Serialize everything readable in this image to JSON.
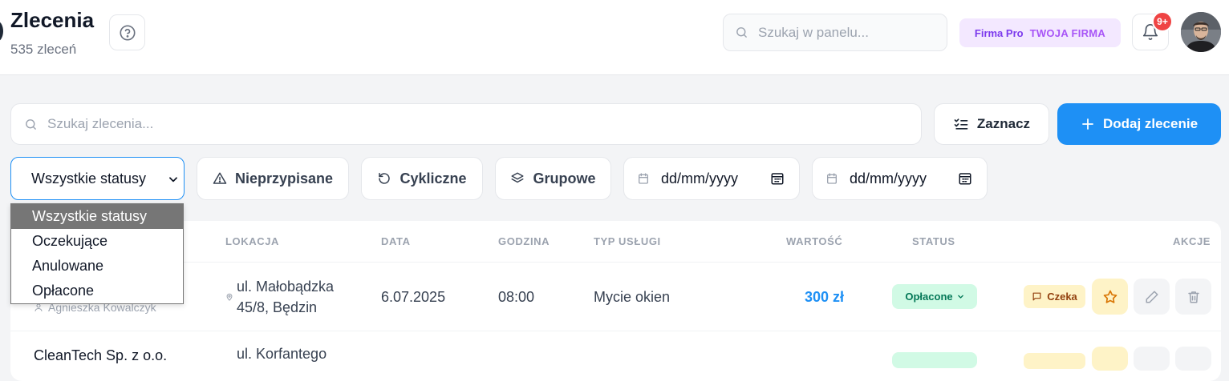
{
  "header": {
    "title": "Zlecenia",
    "subtitle": "535 zleceń",
    "search_placeholder": "Szukaj w panelu...",
    "plan_name": "Firma Pro",
    "company": "TWOJA FIRMA",
    "notifications_badge": "9+"
  },
  "toolbar": {
    "search_placeholder": "Szukaj zlecenia...",
    "select_label": "Zaznacz",
    "add_label": "Dodaj zlecenie"
  },
  "filters": {
    "status_selected": "Wszystkie statusy",
    "unassigned": "Nieprzypisane",
    "recurring": "Cykliczne",
    "group": "Grupowe",
    "date_from": "dd/mm/yyyy",
    "date_to": "dd/mm/yyyy",
    "status_options": [
      "Wszystkie statusy",
      "Oczekujące",
      "Anulowane",
      "Opłacone"
    ]
  },
  "table": {
    "columns": {
      "location": "LOKACJA",
      "date": "DATA",
      "time": "GODZINA",
      "service": "TYP USŁUGI",
      "value": "WARTOŚĆ",
      "status": "STATUS",
      "actions": "AKCJE"
    },
    "rows": [
      {
        "client_sub": "Agnieszka Kowalczyk",
        "location_line1": "ul. Małobądzka",
        "location_line2": "45/8, Będzin",
        "date": "6.07.2025",
        "time": "08:00",
        "service": "Mycie okien",
        "value": "300 zł",
        "status": "Opłacone",
        "note": "Czeka"
      },
      {
        "client": "CleanTech Sp. z o.o.",
        "location_line1": "ul. Korfantego"
      }
    ]
  },
  "colors": {
    "accent": "#1e90f5",
    "paid_bg": "#d1fae5",
    "paid_text": "#047857",
    "plan_bg": "#f3e8ff",
    "badge_red": "#ef4444"
  }
}
